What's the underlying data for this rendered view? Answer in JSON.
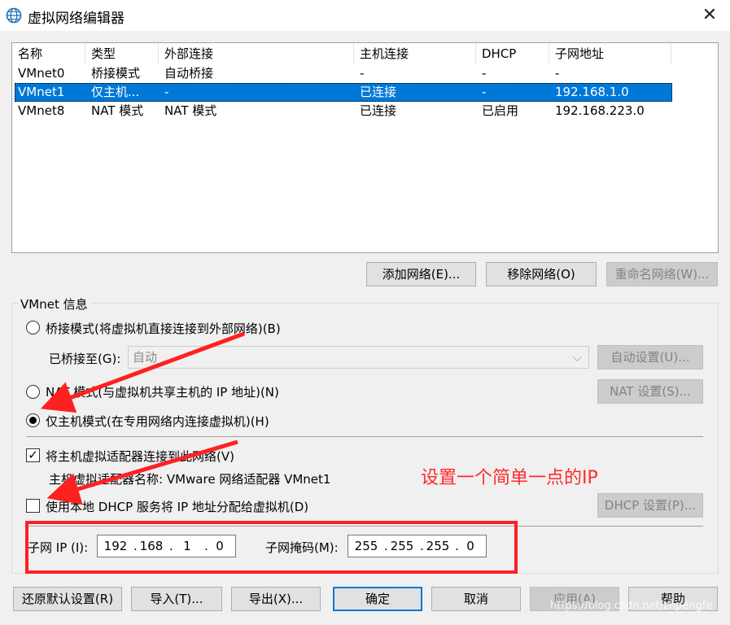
{
  "window": {
    "title": "虚拟网络编辑器",
    "close_glyph": "✕"
  },
  "table": {
    "columns": [
      "名称",
      "类型",
      "外部连接",
      "主机连接",
      "DHCP",
      "子网地址"
    ],
    "rows": [
      [
        "VMnet0",
        "桥接模式",
        "自动桥接",
        "-",
        "-",
        "-"
      ],
      [
        "VMnet1",
        "仅主机...",
        "-",
        "已连接",
        "-",
        "192.168.1.0"
      ],
      [
        "VMnet8",
        "NAT 模式",
        "NAT 模式",
        "已连接",
        "已启用",
        "192.168.223.0"
      ]
    ],
    "selected_row": 1
  },
  "network_buttons": {
    "add": "添加网络(E)...",
    "remove": "移除网络(O)",
    "rename": "重命名网络(W)..."
  },
  "vmnet_info": {
    "group_title": "VMnet 信息",
    "bridged_label": "桥接模式(将虚拟机直接连接到外部网络)(B)",
    "bridged_to_label": "已桥接至(G):",
    "bridged_to_value": "自动",
    "auto_settings": "自动设置(U)...",
    "nat_label": "NAT 模式(与虚拟机共享主机的 IP 地址)(N)",
    "nat_settings": "NAT 设置(S)...",
    "hostonly_label": "仅主机模式(在专用网络内连接虚拟机)(H)",
    "selected_mode": "hostonly",
    "connect_adapter_label": "将主机虚拟适配器连接到此网络(V)",
    "connect_adapter_checked": true,
    "adapter_name_text": "主机虚拟适配器名称: VMware 网络适配器 VMnet1",
    "dhcp_label": "使用本地 DHCP 服务将 IP 地址分配给虚拟机(D)",
    "dhcp_checked": false,
    "dhcp_settings": "DHCP 设置(P)...",
    "subnet_ip_label": "子网 IP (I):",
    "subnet_ip": [
      "192",
      "168",
      "1",
      "0"
    ],
    "subnet_mask_label": "子网掩码(M):",
    "subnet_mask": [
      "255",
      "255",
      "255",
      "0"
    ]
  },
  "footer_buttons": {
    "restore": "还原默认设置(R)",
    "import": "导入(T)...",
    "export": "导出(X)...",
    "ok": "确定",
    "cancel": "取消",
    "apply": "应用(A)",
    "help": "帮助"
  },
  "annotation": {
    "text": "设置一个简单一点的IP",
    "color": "#ff2020"
  },
  "watermark": "https://blog.csdn.net/zhpengfe"
}
